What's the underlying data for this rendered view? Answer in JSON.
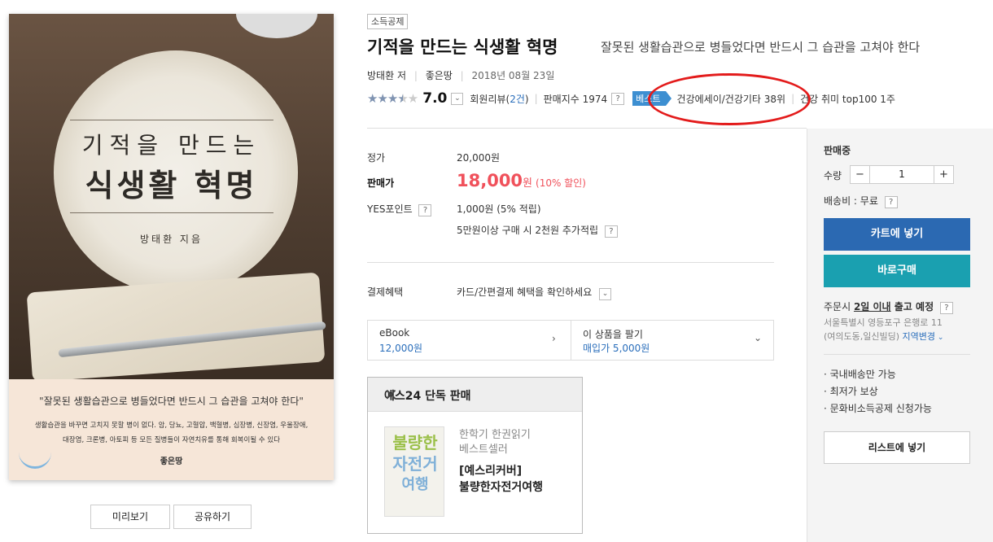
{
  "cover": {
    "title_line1": "기적을 만드는",
    "title_line2": "식생활 혁명",
    "author": "방태환 지음",
    "quote": "\"잘못된 생활습관으로 병들었다면 반드시 그 습관을 고쳐야 한다\"",
    "desc": "생활습관을 바꾸면 고치지 못할 병이 없다. 암, 당뇨, 고혈압, 백혈병, 심장병, 신장염, 우울장애, 대장염, 크론병, 아토피 등 모든 질병들이 자연치유를 통해 회복이될 수 있다",
    "publisher_logo": "좋은땅"
  },
  "cover_buttons": {
    "preview": "미리보기",
    "share": "공유하기"
  },
  "product": {
    "badge": "소득공제",
    "title": "기적을 만드는 식생활 혁명",
    "subtitle": "잘못된 생활습관으로 병들었다면 반드시 그 습관을 고쳐야 한다",
    "author": "방태환",
    "author_role": "저",
    "publisher": "좋은땅",
    "date": "2018년 08월 23일"
  },
  "rating": {
    "score": "7.0",
    "stars_filled": 3.5,
    "reviews_label": "회원리뷰(",
    "reviews_count": "2건",
    "reviews_close": ")",
    "sales_index": "판매지수 1974",
    "help": "?",
    "best_tag": "베스트",
    "best_category": "건강에세이/건강기타 38위",
    "best_rank2": "건강 취미 top100 1주"
  },
  "price": {
    "list_label": "정가",
    "list_value": "20,000원",
    "sale_label": "판매가",
    "sale_amount": "18,000",
    "sale_unit": "원",
    "sale_discount": "(10% 할인)",
    "points_label": "YES포인트",
    "points_value": "1,000원 (5% 적립)",
    "points_extra": "5만원이상 구매 시 2천원 추가적립",
    "payment_label": "결제혜택",
    "payment_value": "카드/간편결제 혜택을 확인하세요"
  },
  "options": {
    "ebook_label": "eBook",
    "ebook_price": "12,000원",
    "sell_label": "이 상품을 팔기",
    "sell_price": "매입가 5,000원"
  },
  "exclusive": {
    "header": "예스24 단독 판매",
    "mini_cover_line1": "불량한",
    "mini_cover_line2": "자전거",
    "mini_cover_line3": "여행",
    "sub1": "한학기 한권읽기",
    "sub2": "베스트셀러",
    "name1": "[예스리커버]",
    "name2": "불량한자전거여행"
  },
  "sidebar": {
    "status": "판매중",
    "qty_label": "수량",
    "qty_value": "1",
    "shipping": "배송비 : 무료",
    "cart_btn": "카트에 넣기",
    "buy_btn": "바로구매",
    "delivery_prefix": "주문시 ",
    "delivery_days": "2일 이내",
    "delivery_suffix": " 출고 예정",
    "address_line1": "서울특별시 영등포구 은행로 11",
    "address_line2": "(여의도동,일신빌딩) ",
    "region_change": "지역변경",
    "bullets": [
      "국내배송만 가능",
      "최저가 보상",
      "문화비소득공제 신청가능"
    ],
    "wish_btn": "리스트에 넣기"
  },
  "colors": {
    "cart_btn": "#2b69b2",
    "buy_btn": "#1aa0b0",
    "sale_red": "#f0515b",
    "link_blue": "#2a6ebb",
    "annotation_red": "#e31b1b"
  }
}
